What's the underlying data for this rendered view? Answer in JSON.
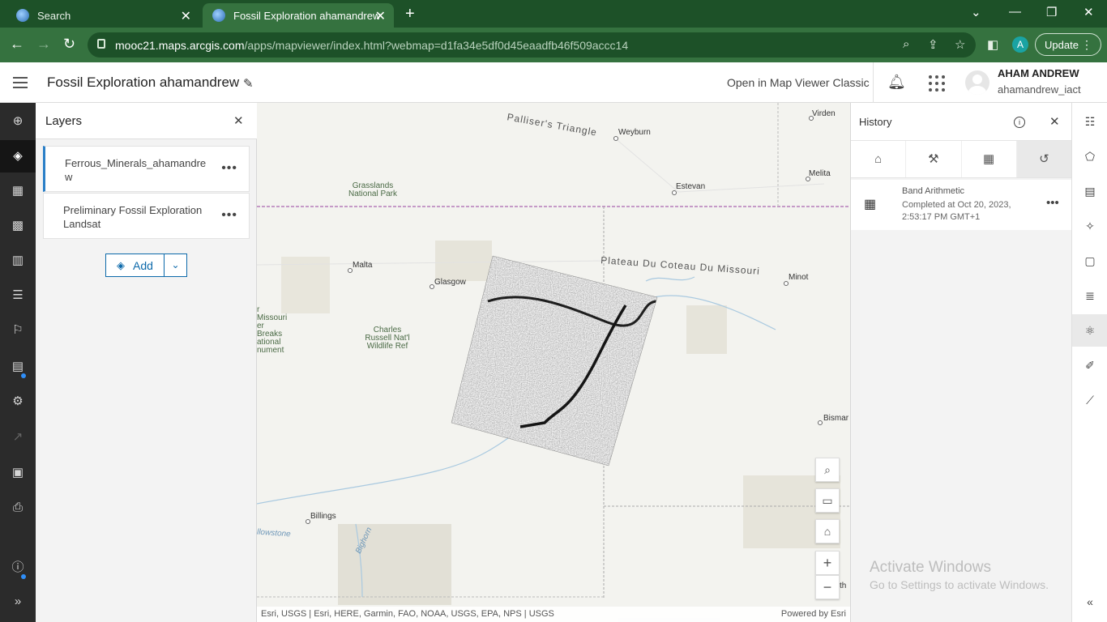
{
  "browser": {
    "tabs": [
      {
        "title": "Search"
      },
      {
        "title": "Fossil Exploration ahamandrew"
      }
    ],
    "url_host": "mooc21.maps.arcgis.com",
    "url_path": "/apps/mapviewer/index.html?webmap=d1fa34e5df0d45eaadfb46f509accc14",
    "profile_initial": "A",
    "update_label": "Update"
  },
  "header": {
    "map_title": "Fossil Exploration ahamandrew",
    "open_classic_label": "Open in Map Viewer Classic",
    "user_name": "AHAM ANDREW",
    "user_handle": "ahamandrew_iact"
  },
  "layers_panel": {
    "title": "Layers",
    "layers": [
      {
        "name": "Ferrous_Minerals_ahamandrew"
      },
      {
        "name": "Preliminary Fossil Exploration Landsat"
      }
    ],
    "add_label": "Add"
  },
  "map": {
    "labels": {
      "palliser": "Palliser's Triangle",
      "weyburn": "Weyburn",
      "virden": "Virden",
      "melita": "Melita",
      "estevan": "Estevan",
      "grasslands": "Grasslands National Park",
      "malta": "Malta",
      "glasgow": "Glasgow",
      "plateau": "Plateau Du Coteau Du Missouri",
      "minot": "Minot",
      "missouri_breaks": "r Missouri er Breaks ational nument",
      "charles_russell": "Charles Russell Nat'l Wildlife Ref",
      "bismarck": "Bismar",
      "billings": "Billings",
      "yellowstone": "llowstone",
      "bighorn": "Bighorn",
      "th": "th"
    },
    "attribution": "Esri, USGS | Esri, HERE, Garmin, FAO, NOAA, USGS, EPA, NPS | USGS",
    "powered_by": "Powered by Esri"
  },
  "history_panel": {
    "title": "History",
    "entries": [
      {
        "title": "Band Arithmetic",
        "status": "Completed at Oct 20, 2023, 2:53:17 PM GMT+1"
      }
    ]
  },
  "watermark": {
    "line1": "Activate Windows",
    "line2": "Go to Settings to activate Windows."
  }
}
